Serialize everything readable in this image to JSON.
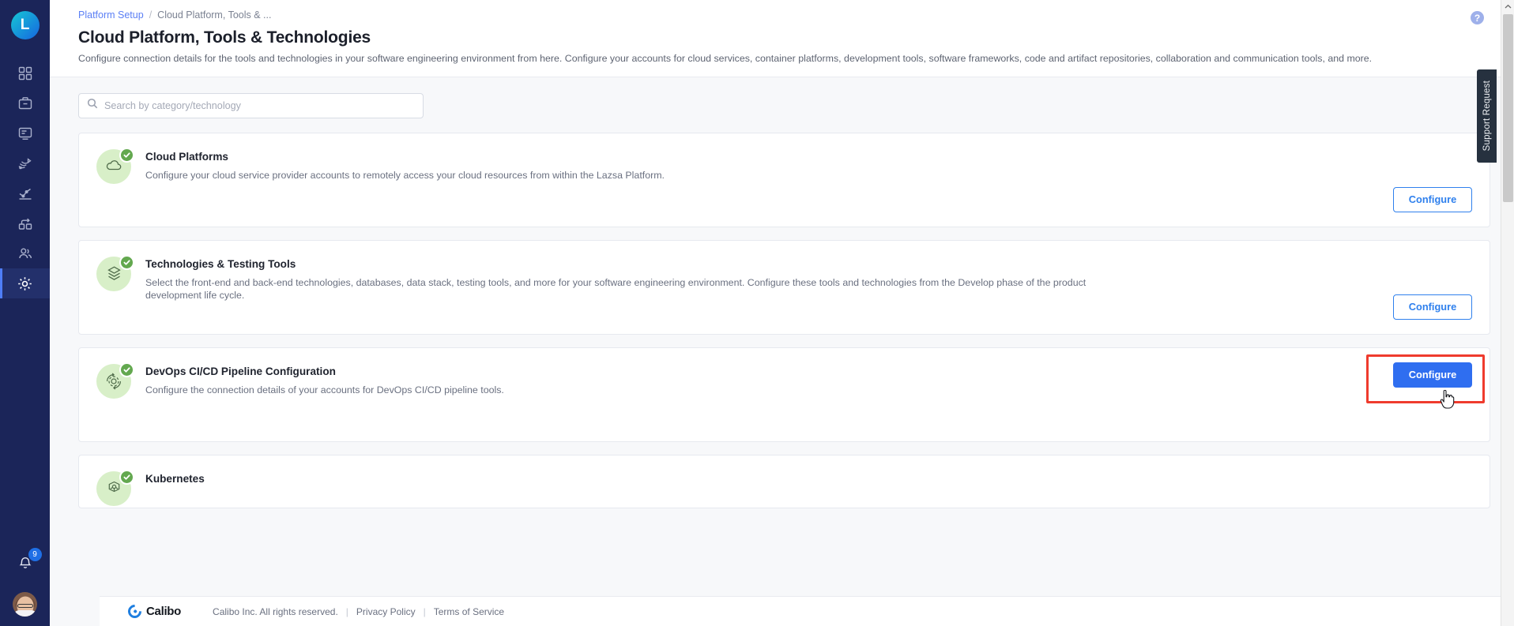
{
  "sidebar": {
    "logo_text": "L",
    "items": [
      {
        "name": "dashboard",
        "icon": "grid-icon"
      },
      {
        "name": "portfolio",
        "icon": "briefcase-icon"
      },
      {
        "name": "board",
        "icon": "board-icon"
      },
      {
        "name": "data-pipeline",
        "icon": "data-flow-icon"
      },
      {
        "name": "analytics",
        "icon": "analytics-icon"
      },
      {
        "name": "integrations",
        "icon": "integration-icon"
      },
      {
        "name": "users",
        "icon": "users-icon"
      },
      {
        "name": "settings",
        "icon": "gear-icon"
      }
    ],
    "notifications": {
      "icon": "bell-icon",
      "count": "9"
    },
    "avatar": {
      "icon": "avatar"
    }
  },
  "header": {
    "breadcrumb": {
      "parent": "Platform Setup",
      "separator": "/",
      "current": "Cloud Platform, Tools & ..."
    },
    "title": "Cloud Platform, Tools & Technologies",
    "description": "Configure connection details for the tools and technologies in your software engineering environment from here. Configure your accounts for cloud services, container platforms, development tools, software frameworks, code and artifact repositories, collaboration and communication tools, and more.",
    "help_icon": "?"
  },
  "search": {
    "placeholder": "Search by category/technology",
    "value": "",
    "icon": "search-icon"
  },
  "cards": [
    {
      "title": "Cloud Platforms",
      "description": "Configure your cloud service provider accounts to remotely access your cloud resources from within the Lazsa Platform.",
      "button_label": "Configure",
      "icon": "cloud-icon",
      "status": "configured"
    },
    {
      "title": "Technologies & Testing Tools",
      "description": "Select the front-end and back-end technologies, databases, data stack, testing tools, and more for your software engineering environment. Configure these tools and technologies from the Develop phase of the product development life cycle.",
      "button_label": "Configure",
      "icon": "layers-icon",
      "status": "configured"
    },
    {
      "title": "DevOps CI/CD Pipeline Configuration",
      "description": "Configure the connection details of your accounts for DevOps CI/CD pipeline tools.",
      "button_label": "Configure",
      "icon": "devops-gear-icon",
      "status": "configured"
    },
    {
      "title": "Kubernetes",
      "description": "",
      "button_label": "",
      "icon": "kubernetes-icon",
      "status": "configured"
    }
  ],
  "support": {
    "label": "Support Request"
  },
  "footer": {
    "logo_text": "Calibo",
    "copyright": "Calibo Inc. All rights reserved.",
    "divider": "|",
    "privacy_label": "Privacy Policy",
    "terms_label": "Terms of Service"
  },
  "colors": {
    "sidebar_bg": "#1b2559",
    "accent_blue": "#2f6ef0",
    "link_blue": "#5b7ff5",
    "status_green": "#63a84f",
    "icon_blob": "#d8efc8",
    "highlight_red": "#ef3b2d"
  }
}
